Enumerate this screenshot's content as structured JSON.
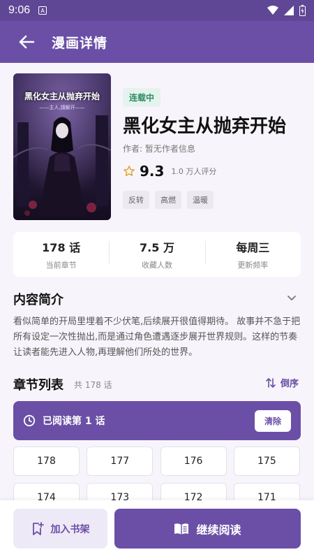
{
  "status_bar": {
    "time": "9:06",
    "notif_glyph": "A"
  },
  "header": {
    "title": "漫画详情",
    "back_icon": "arrow-left-icon"
  },
  "comic": {
    "cover_title": "黑化女主从抛弃开始",
    "cover_subtitle": "——主人,請解开——",
    "status": "连载中",
    "title": "黑化女主从抛弃开始",
    "author": "作者: 暂无作者信息",
    "rating": "9.3",
    "rating_count": "1.0 万人评分",
    "tags": [
      "反转",
      "高燃",
      "温暖"
    ]
  },
  "stats": [
    {
      "value": "178 话",
      "label": "当前章节"
    },
    {
      "value": "7.5 万",
      "label": "收藏人数"
    },
    {
      "value": "每周三",
      "label": "更新频率"
    }
  ],
  "intro": {
    "title": "内容简介",
    "text": "看似简单的开局里埋着不少伏笔,后续展开很值得期待。 故事并不急于把所有设定一次性抛出,而是通过角色遭遇逐步展开世界规则。这样的节奏让读者能先进入人物,再理解他们所处的世界。"
  },
  "chapters": {
    "title": "章节列表",
    "count": "共 178 话",
    "sort_label": "倒序",
    "progress": "已阅读第 1 话",
    "clear_label": "清除",
    "items": [
      "178",
      "177",
      "176",
      "175",
      "174",
      "173",
      "172",
      "171"
    ]
  },
  "bottom": {
    "shelf_label": "加入书架",
    "continue_label": "继续阅读"
  },
  "colors": {
    "primary": "#6b4fa6",
    "status_bar": "#5f4795",
    "serial_green": "#2f8b62",
    "star": "#e0a63a"
  }
}
